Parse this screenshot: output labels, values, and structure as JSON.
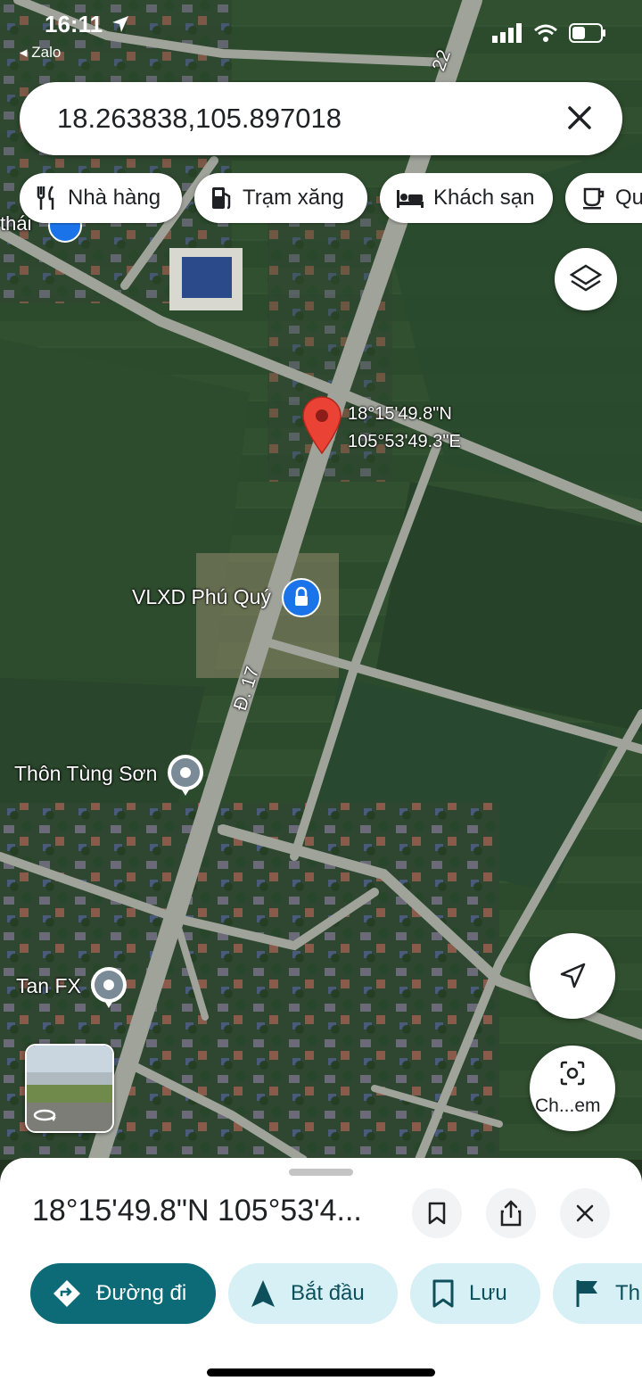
{
  "status_bar": {
    "time": "16:11",
    "back_app": "◂ Zalo"
  },
  "search": {
    "query": "18.263838,105.897018"
  },
  "chips": [
    {
      "label": "Nhà hàng",
      "icon": "restaurant-icon"
    },
    {
      "label": "Trạm xăng",
      "icon": "gas-station-icon"
    },
    {
      "label": "Khách sạn",
      "icon": "hotel-icon"
    },
    {
      "label": "Qu",
      "icon": "coffee-icon"
    }
  ],
  "map": {
    "pin_coord_line1": "18°15'49.8\"N",
    "pin_coord_line2": "105°53'49.3\"E",
    "road_label_top": "22",
    "road_label_d17": "Đ. 17",
    "place_top_left": "thái",
    "places": [
      {
        "name": "VLXD Phú Quý",
        "icon": "store-lock-pin-icon"
      },
      {
        "name": "Thôn Tùng Sơn",
        "icon": "place-pin-icon"
      },
      {
        "name": "Tan FX",
        "icon": "place-pin-icon"
      }
    ],
    "lens_label": "Ch...em"
  },
  "sheet": {
    "title": "18°15'49.8\"N 105°53'4...",
    "actions": [
      {
        "label": "Đường đi",
        "icon": "directions-icon"
      },
      {
        "label": "Bắt đầu",
        "icon": "navigate-arrow-icon"
      },
      {
        "label": "Lưu",
        "icon": "bookmark-icon"
      },
      {
        "label": "Th",
        "icon": "flag-icon"
      }
    ]
  },
  "colors": {
    "primary": "#0d6b78",
    "secondary_bg": "#d6f0f5",
    "pin": "#ea4335"
  }
}
